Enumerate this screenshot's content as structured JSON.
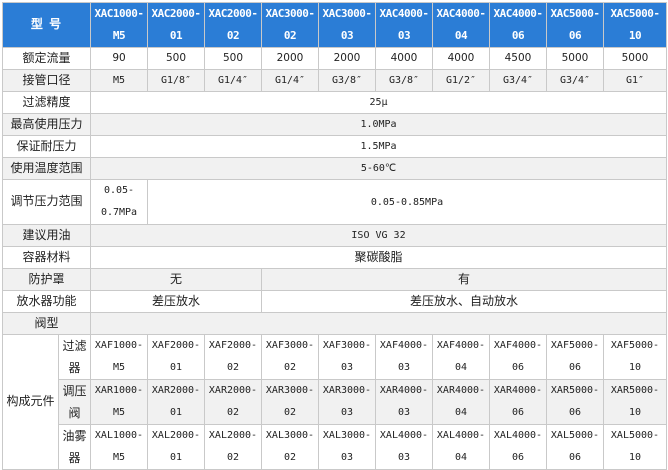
{
  "header": {
    "label": "型 号",
    "models": [
      [
        "XAC1000-",
        "M5"
      ],
      [
        "XAC2000-",
        "01"
      ],
      [
        "XAC2000-",
        "02"
      ],
      [
        "XAC3000-",
        "02"
      ],
      [
        "XAC3000-",
        "03"
      ],
      [
        "XAC4000-",
        "03"
      ],
      [
        "XAC4000-",
        "04"
      ],
      [
        "XAC4000-",
        "06"
      ],
      [
        "XAC5000-",
        "06"
      ],
      [
        "XAC5000-",
        "10"
      ]
    ]
  },
  "rows": {
    "rated_flow": {
      "label": "额定流量",
      "values": [
        "90",
        "500",
        "500",
        "2000",
        "2000",
        "4000",
        "4000",
        "4500",
        "5000",
        "5000"
      ]
    },
    "port_size": {
      "label": "接管口径",
      "values": [
        "M5",
        "G1/8″",
        "G1/4″",
        "G1/4″",
        "G3/8″",
        "G3/8″",
        "G1/2″",
        "G3/4″",
        "G3/4″",
        "G1″"
      ]
    },
    "filtration": {
      "label": "过滤精度",
      "value": "25μ"
    },
    "max_pressure": {
      "label": "最高使用压力",
      "value": "1.0MPa"
    },
    "proof_pressure": {
      "label": "保证耐压力",
      "value": "1.5MPa"
    },
    "temp_range": {
      "label": "使用温度范围",
      "value": "5-60℃"
    },
    "reg_range": {
      "label": "调节压力范围",
      "value_first_a": "0.05-",
      "value_first_b": "0.7MPa",
      "value_rest": "0.05-0.85MPa"
    },
    "oil": {
      "label": "建议用油",
      "value": "ISO VG 32"
    },
    "material": {
      "label": "容器材料",
      "value": "聚碳酸脂"
    },
    "guard": {
      "label": "防护罩",
      "value_a": "无",
      "value_b": "有"
    },
    "drain": {
      "label": "放水器功能",
      "value_a": "差压放水",
      "value_b": "差压放水、自动放水"
    },
    "valve": {
      "label": "阀型"
    }
  },
  "components": {
    "group_label": "构成元件",
    "filter": {
      "label_a": "过滤",
      "label_b": "器",
      "models": [
        [
          "XAF1000-",
          "M5"
        ],
        [
          "XAF2000-",
          "01"
        ],
        [
          "XAF2000-",
          "02"
        ],
        [
          "XAF3000-",
          "02"
        ],
        [
          "XAF3000-",
          "03"
        ],
        [
          "XAF4000-",
          "03"
        ],
        [
          "XAF4000-",
          "04"
        ],
        [
          "XAF4000-",
          "06"
        ],
        [
          "XAF5000-",
          "06"
        ],
        [
          "XAF5000-",
          "10"
        ]
      ]
    },
    "regulator": {
      "label_a": "调压",
      "label_b": "阀",
      "models": [
        [
          "XAR1000-",
          "M5"
        ],
        [
          "XAR2000-",
          "01"
        ],
        [
          "XAR2000-",
          "02"
        ],
        [
          "XAR3000-",
          "02"
        ],
        [
          "XAR3000-",
          "03"
        ],
        [
          "XAR4000-",
          "03"
        ],
        [
          "XAR4000-",
          "04"
        ],
        [
          "XAR4000-",
          "06"
        ],
        [
          "XAR5000-",
          "06"
        ],
        [
          "XAR5000-",
          "10"
        ]
      ]
    },
    "lubricator": {
      "label_a": "油雾",
      "label_b": "器",
      "models": [
        [
          "XAL1000-",
          "M5"
        ],
        [
          "XAL2000-",
          "01"
        ],
        [
          "XAL2000-",
          "02"
        ],
        [
          "XAL3000-",
          "02"
        ],
        [
          "XAL3000-",
          "03"
        ],
        [
          "XAL4000-",
          "03"
        ],
        [
          "XAL4000-",
          "04"
        ],
        [
          "XAL4000-",
          "06"
        ],
        [
          "XAL5000-",
          "06"
        ],
        [
          "XAL5000-",
          "10"
        ]
      ]
    }
  },
  "colors": {
    "header_bg": "#2b7dd6",
    "alt_row_bg": "#f1f1f1",
    "border": "#c9c9c9"
  }
}
